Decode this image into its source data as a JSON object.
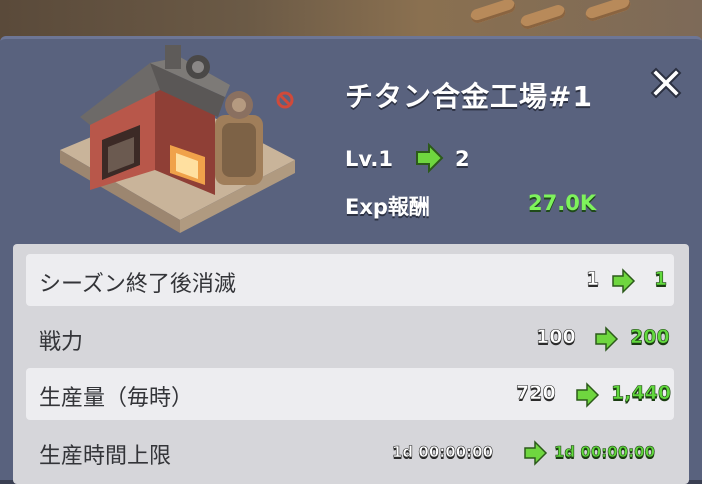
{
  "building": {
    "title": "チタン合金工場#1",
    "level_label": "Lv.1",
    "level_next": "2",
    "exp_label": "Exp報酬",
    "exp_value": "27.0K"
  },
  "stats": [
    {
      "label": "シーズン終了後消滅",
      "from": "1",
      "to": "1"
    },
    {
      "label": "戦力",
      "from": "100",
      "to": "200"
    },
    {
      "label": "生産量（毎時）",
      "from": "720",
      "to": "1,440"
    },
    {
      "label": "生産時間上限",
      "from": "1d 00:00:00",
      "to": "1d 00:00:00"
    }
  ],
  "colors": {
    "panel": "#59627e",
    "accent_green": "#7ef35c",
    "arrow_green": "#6fd63f"
  },
  "icons": {
    "close": "close-x-icon",
    "arrow": "green-arrow-right-icon"
  }
}
